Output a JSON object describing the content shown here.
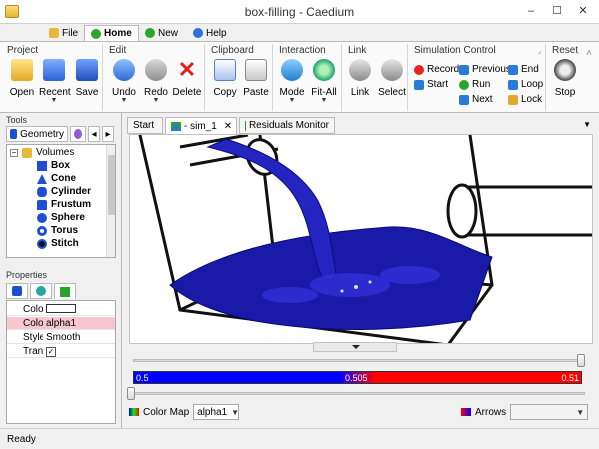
{
  "window": {
    "title": "box-filling - Caedium",
    "controls": [
      "–",
      "☐",
      "✕"
    ]
  },
  "menu": {
    "tabs": [
      "File",
      "Home",
      "New",
      "Help"
    ],
    "active_tab": "Home"
  },
  "ribbon": {
    "groups": {
      "project": {
        "title": "Project",
        "buttons": [
          "Open",
          "Recent",
          "Save"
        ]
      },
      "edit": {
        "title": "Edit",
        "buttons": [
          "Undo",
          "Redo",
          "Delete"
        ]
      },
      "clipboard": {
        "title": "Clipboard",
        "buttons": [
          "Copy",
          "Paste"
        ]
      },
      "interaction": {
        "title": "Interaction",
        "buttons": [
          "Mode",
          "Fit-All"
        ]
      },
      "link": {
        "title": "Link",
        "buttons": [
          "Link",
          "Select"
        ]
      },
      "simulation": {
        "title": "Simulation Control",
        "buttons": [
          "Record",
          "Previous",
          "End",
          "Start",
          "Run",
          "Loop",
          "Next",
          "Lock"
        ]
      },
      "reset": {
        "title": "Reset",
        "buttons": [
          "Stop"
        ]
      }
    }
  },
  "tools": {
    "title": "Tools",
    "tab": "Geometry",
    "tree": {
      "root": "Volumes",
      "items": [
        "Box",
        "Cone",
        "Cylinder",
        "Frustum",
        "Sphere",
        "Torus",
        "Stitch"
      ]
    }
  },
  "properties": {
    "title": "Properties",
    "rows": [
      {
        "key": "Color",
        "value": ""
      },
      {
        "key": "Color Ma",
        "value": "alpha1"
      },
      {
        "key": "Style",
        "value": "Smooth"
      },
      {
        "key": "Transpar",
        "value": "✓"
      }
    ]
  },
  "document": {
    "tabs": [
      "Start",
      "- sim_1",
      "Residuals Monitor"
    ],
    "active_tab": "- sim_1",
    "colorbar": {
      "min": "0.5",
      "mid": "0.505",
      "max": "0.51"
    },
    "color_map_label": "Color Map",
    "color_map_value": "alpha1",
    "arrows_label": "Arrows",
    "arrows_value": ""
  },
  "status": {
    "text": "Ready"
  },
  "colors": {
    "accent": "#1d4fd6",
    "fluid": "#1a1aa8",
    "colorbar_low": "#0000ff",
    "colorbar_high": "#ff0000"
  }
}
